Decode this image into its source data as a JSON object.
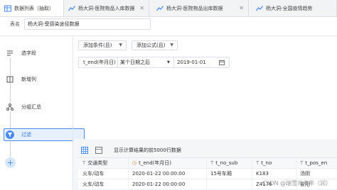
{
  "tabs": [
    {
      "label": "数据列表（抽取）",
      "icon": "table-icon",
      "active": true
    },
    {
      "label": "杨大洞-医院物品入库数据",
      "icon": "line-chart-icon",
      "active": false
    },
    {
      "label": "杨大洞-医院物品出库数据",
      "icon": "line-chart-icon",
      "active": false
    },
    {
      "label": "杨大洞-全国疫情趋势",
      "icon": "line-chart-icon",
      "active": false
    }
  ],
  "table_name": {
    "label": "表名",
    "value": "杨大洞-受感染途径数据"
  },
  "steps": [
    {
      "label": "选字段",
      "icon": "select-field-icon"
    },
    {
      "label": "新增列",
      "icon": "add-column-icon"
    },
    {
      "label": "分组汇总",
      "icon": "group-summary-icon"
    },
    {
      "label": "过滤",
      "icon": "filter-icon",
      "active": true
    }
  ],
  "add_step_icon": "plus-icon",
  "filter": {
    "add_condition": "添加条件(且)",
    "add_formula": "添加公式(且)",
    "condition": {
      "field": "t_end(年月日)",
      "operator": "某个日期之后",
      "value": "2019-01-01"
    }
  },
  "result": {
    "note": "显示计算结果的前5000行数据",
    "columns": [
      {
        "label": "交通类型",
        "icon": "T"
      },
      {
        "label": "t_end(年月日)",
        "icon": "clock-icon"
      },
      {
        "label": "t_no_sub",
        "icon": "T"
      },
      {
        "label": "t_no",
        "icon": "T"
      },
      {
        "label": "t_pos_en",
        "icon": "T"
      }
    ],
    "rows": [
      [
        "火车/动车",
        "2020-01-22 00:00:00",
        "15号车厢",
        "K183",
        "汤阴"
      ],
      [
        "火车/动车",
        "2020-01-22 00:00:00",
        "",
        "Z4176",
        "安阳"
      ]
    ]
  },
  "watermark": "CSDN @瑞雪兆丰年（润）",
  "colors": {
    "accent": "#4a8af4",
    "active_bg": "#e6f0ff"
  }
}
